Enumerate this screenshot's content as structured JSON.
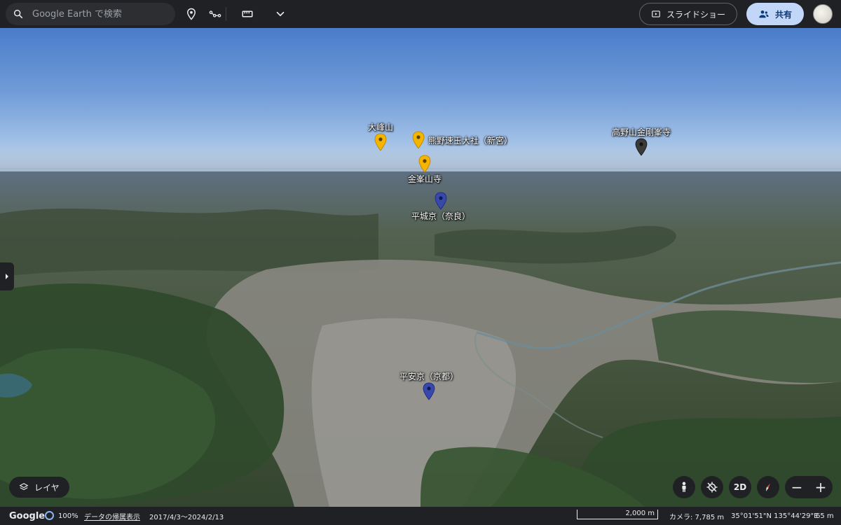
{
  "search": {
    "placeholder": "Google Earth で検索"
  },
  "toolbar": {
    "icons": [
      "place-pin-icon",
      "path-icon",
      "ruler-icon",
      "chevron-down-icon"
    ],
    "slideshow_label": "スライドショー",
    "share_label": "共有"
  },
  "places": [
    {
      "name": "大峰山",
      "color": "#f4b400"
    },
    {
      "name": "熊野速玉大社（新宮）",
      "color": "#f4b400"
    },
    {
      "name": "金峯山寺",
      "color": "#f4b400"
    },
    {
      "name": "平城京（奈良）",
      "color": "#3949ab"
    },
    {
      "name": "高野山金剛峯寺",
      "color": "#3a3a3a"
    },
    {
      "name": "平安京（京都）",
      "color": "#3949ab"
    }
  ],
  "controls": {
    "layers_label": "レイヤ",
    "mode_2d": "2D",
    "zoom_out": "−",
    "zoom_in": "+"
  },
  "status": {
    "brand": "Google",
    "load_pct": "100%",
    "attribution": "データの帰属表示",
    "imagery_dates": "2017/4/3〜2024/2/13",
    "scale": "2,000 m",
    "camera": "カメラ: 7,785 m",
    "coords": "35°01'51\"N 135°44'29\"E",
    "altitude": "65 m"
  }
}
